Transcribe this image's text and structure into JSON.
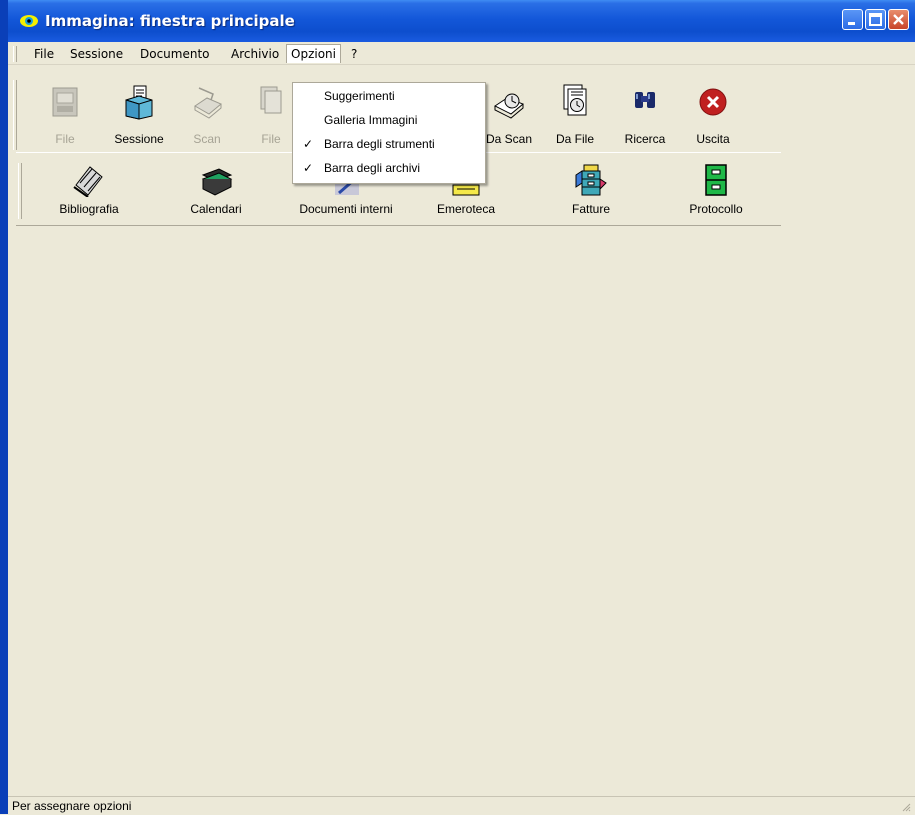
{
  "window": {
    "title": "Immagina: finestra principale"
  },
  "menubar": {
    "items": [
      {
        "label": "File"
      },
      {
        "label": "Sessione"
      },
      {
        "label": "Documento"
      },
      {
        "label": "Archivio"
      },
      {
        "label": "Opzioni"
      },
      {
        "label": "?"
      }
    ]
  },
  "toolbar": {
    "buttons": [
      {
        "label": "File",
        "icon": "scanner-documents-icon",
        "enabled": false
      },
      {
        "label": "Sessione",
        "icon": "session-box-icon",
        "enabled": true
      },
      {
        "label": "Scan",
        "icon": "flatbed-scanner-icon",
        "enabled": false
      },
      {
        "label": "File",
        "icon": "file-pages-icon",
        "enabled": false
      },
      {
        "label": "Da Scan",
        "icon": "scan-clock-icon",
        "enabled": true
      },
      {
        "label": "Da File",
        "icon": "file-clock-icon",
        "enabled": true
      },
      {
        "label": "Ricerca",
        "icon": "binoculars-icon",
        "enabled": true
      },
      {
        "label": "Uscita",
        "icon": "exit-circle-icon",
        "enabled": true
      }
    ]
  },
  "archives": {
    "buttons": [
      {
        "label": "Bibliografia",
        "icon": "books-icon"
      },
      {
        "label": "Calendari",
        "icon": "calendar-scanner-icon"
      },
      {
        "label": "Documenti interni",
        "icon": "pen-document-icon"
      },
      {
        "label": "Emeroteca",
        "icon": "newspaper-icon"
      },
      {
        "label": "Fatture",
        "icon": "invoice-cabinet-icon"
      },
      {
        "label": "Protocollo",
        "icon": "filing-cabinet-icon"
      }
    ]
  },
  "options_menu": {
    "items": [
      {
        "label": "Suggerimenti",
        "checked": false
      },
      {
        "label": "Galleria Immagini",
        "checked": false
      },
      {
        "label": "Barra degli strumenti",
        "checked": true
      },
      {
        "label": "Barra degli archivi",
        "checked": true
      }
    ],
    "check_glyph": "✓"
  },
  "statusbar": {
    "text": "Per assegnare opzioni"
  },
  "colors": {
    "titlebar": "#0d4ecd",
    "face": "#ece9d8",
    "close": "#c8452a"
  }
}
